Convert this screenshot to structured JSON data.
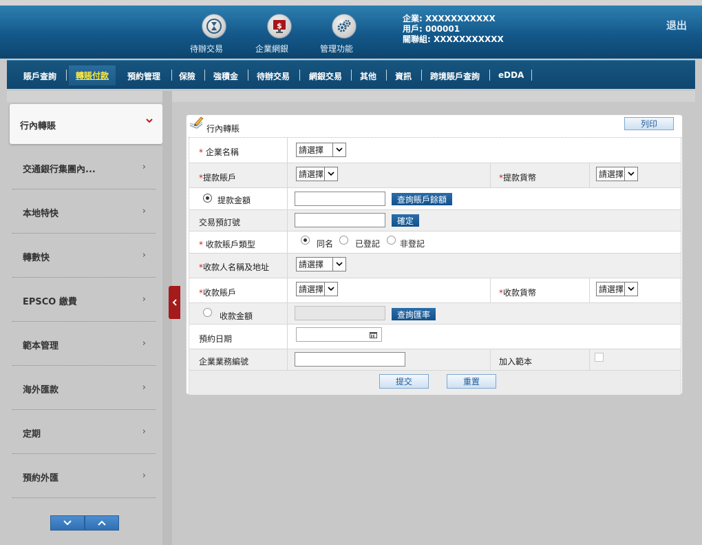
{
  "header": {
    "icons": [
      {
        "label": "待辦交易",
        "icon": "hourglass-cycle-icon"
      },
      {
        "label": "企業網銀",
        "icon": "dollar-monitor-icon"
      },
      {
        "label": "管理功能",
        "icon": "gears-icon"
      }
    ],
    "company": "企業: XXXXXXXXXXX",
    "user": "用戶: 000001",
    "group": "關聯組: XXXXXXXXXXX",
    "logout": "退出"
  },
  "nav": {
    "items": [
      "賬戶查詢",
      "轉賬付款",
      "預約管理",
      "保險",
      "強積金",
      "待辦交易",
      "網銀交易",
      "其他",
      "資訊",
      "跨境賬戶查詢",
      "eDDA"
    ],
    "active": "轉賬付款"
  },
  "sidebar": {
    "items": [
      {
        "label": "行內轉賬",
        "active": true
      },
      {
        "label": "交通銀行集團內..."
      },
      {
        "label": "本地特快"
      },
      {
        "label": "轉數快"
      },
      {
        "label": "EPSCO 繳費"
      },
      {
        "label": "範本管理"
      },
      {
        "label": "海外匯款"
      },
      {
        "label": "定期"
      },
      {
        "label": "預約外匯"
      }
    ],
    "chevron": "›",
    "active_chevron": "⌄"
  },
  "panel": {
    "title": "行內轉賬",
    "print": "列印",
    "form": {
      "company_name": {
        "star": "*",
        "label": " 企業名稱",
        "value": "請選擇"
      },
      "debit_account": {
        "star": "*",
        "label": "提款賬戶",
        "value": "請選擇"
      },
      "debit_currency": {
        "star": "*",
        "label": "提款貨幣",
        "value": "請選擇"
      },
      "debit_amount": {
        "label": "提款金額",
        "button": "查詢賬戶餘額",
        "selected": true
      },
      "transaction_ref": {
        "label": "交易預訂號",
        "button": "確定"
      },
      "payee_account_type": {
        "star": "*",
        "label": " 收款賬戶類型",
        "options": [
          "同名",
          "已登記",
          "非登記"
        ],
        "selected": "同名"
      },
      "payee_name_address": {
        "star": "*",
        "label": "收款人名稱及地址",
        "value": "請選擇"
      },
      "credit_account": {
        "star": "*",
        "label": "收款賬戶",
        "value": "請選擇"
      },
      "credit_currency": {
        "star": "*",
        "label": "收款貨幣",
        "value": "請選擇"
      },
      "credit_amount": {
        "label": "收款金額",
        "button": "查詢匯率",
        "selected": false
      },
      "scheduled_date": {
        "label": "預約日期"
      },
      "business_ref": {
        "label": "企業業務編號"
      },
      "add_template": {
        "label": "加入範本",
        "checked": false
      }
    },
    "submit": "提交",
    "reset": "重置"
  },
  "colors": {
    "header_top": "#2d7fb1",
    "header_bottom": "#0c456e",
    "nav": "#14507a",
    "active_nav_text": "#ffea3a",
    "required_star": "#c81e1e",
    "action_blue": "#1b5f9c",
    "collapse_tab": "#a51a1a"
  }
}
